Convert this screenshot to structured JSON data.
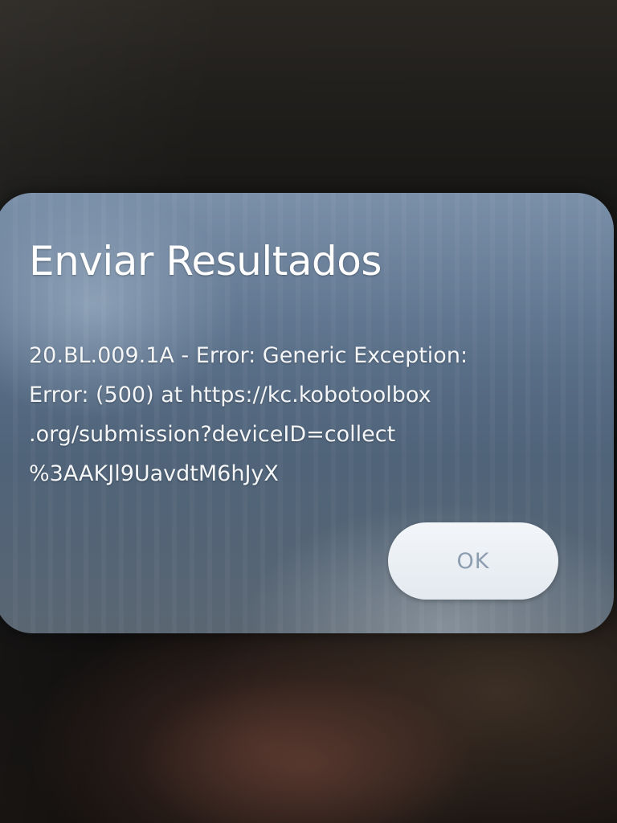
{
  "dialog": {
    "title": "Enviar Resultados",
    "message_lines": [
      "20.BL.009.1A - Error: Generic Exception:",
      "Error:  (500) at https://kc.kobotoolbox",
      ".org/submission?deviceID=collect",
      "%3AAKJl9UavdtM6hJyX"
    ],
    "ok_label": "OK"
  },
  "colors": {
    "dialog_background": "#5d738d",
    "text": "#ffffff",
    "button_background": "#eef2f6",
    "button_text": "#8c9db0",
    "screen_background": "#151515"
  }
}
